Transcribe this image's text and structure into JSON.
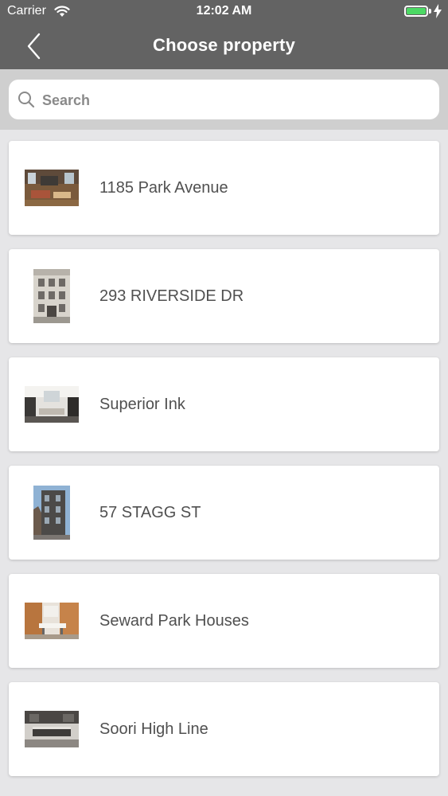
{
  "status_bar": {
    "carrier": "Carrier",
    "time": "12:02 AM",
    "battery_color": "#4cd964"
  },
  "nav": {
    "back_icon": "chevron-left-icon",
    "title": "Choose property"
  },
  "search": {
    "placeholder": "Search",
    "icon": "search-icon"
  },
  "properties": [
    {
      "name": "1185 Park Avenue",
      "thumbnail": "interior-room-photo"
    },
    {
      "name": "293 RIVERSIDE DR",
      "thumbnail": "building-facade-photo"
    },
    {
      "name": "Superior Ink",
      "thumbnail": "interior-living-photo"
    },
    {
      "name": "57 STAGG ST",
      "thumbnail": "building-exterior-photo"
    },
    {
      "name": "Seward Park Houses",
      "thumbnail": "dining-room-photo"
    },
    {
      "name": "Soori High Line",
      "thumbnail": "kitchen-photo"
    }
  ],
  "colors": {
    "header_bg": "#636363",
    "search_area_bg": "#cfcfcf",
    "list_bg": "#e6e6e8",
    "label_text": "#505050"
  }
}
